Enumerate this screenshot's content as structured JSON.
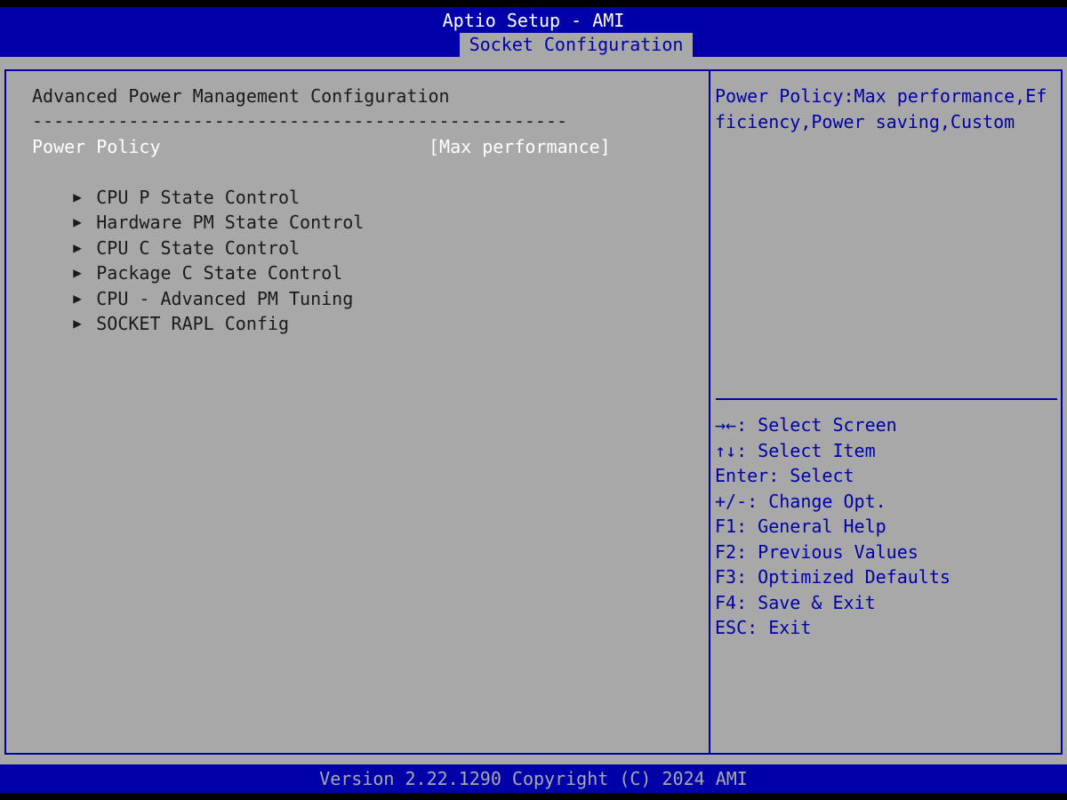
{
  "header": {
    "title": "Aptio Setup - AMI",
    "active_tab": "Socket Configuration"
  },
  "main": {
    "section_title": "Advanced Power Management Configuration",
    "separator": "--------------------------------------------------",
    "setting": {
      "label": "Power Policy",
      "value": "[Max performance]"
    },
    "submenus": [
      {
        "label": "CPU P State Control"
      },
      {
        "label": "Hardware PM State Control"
      },
      {
        "label": "CPU C State Control"
      },
      {
        "label": "Package C State Control"
      },
      {
        "label": "CPU - Advanced PM Tuning"
      },
      {
        "label": "SOCKET RAPL Config"
      }
    ],
    "submenu_icon": "right-triangle-icon"
  },
  "help": {
    "text": "Power Policy:Max performance,Efficiency,Power saving,Custom",
    "keys": [
      "→←: Select Screen",
      "↑↓: Select Item",
      "Enter: Select",
      "+/-: Change Opt.",
      "F1: General Help",
      "F2: Previous Values",
      "F3: Optimized Defaults",
      "F4: Save & Exit",
      "ESC: Exit"
    ]
  },
  "footer": {
    "version": "Version 2.22.1290 Copyright (C) 2024 AMI"
  },
  "colors": {
    "bios_blue": "#0000a8",
    "bios_gray": "#a8a8a8",
    "highlight_text": "#ffffff",
    "normal_text": "#1a1a1a"
  }
}
